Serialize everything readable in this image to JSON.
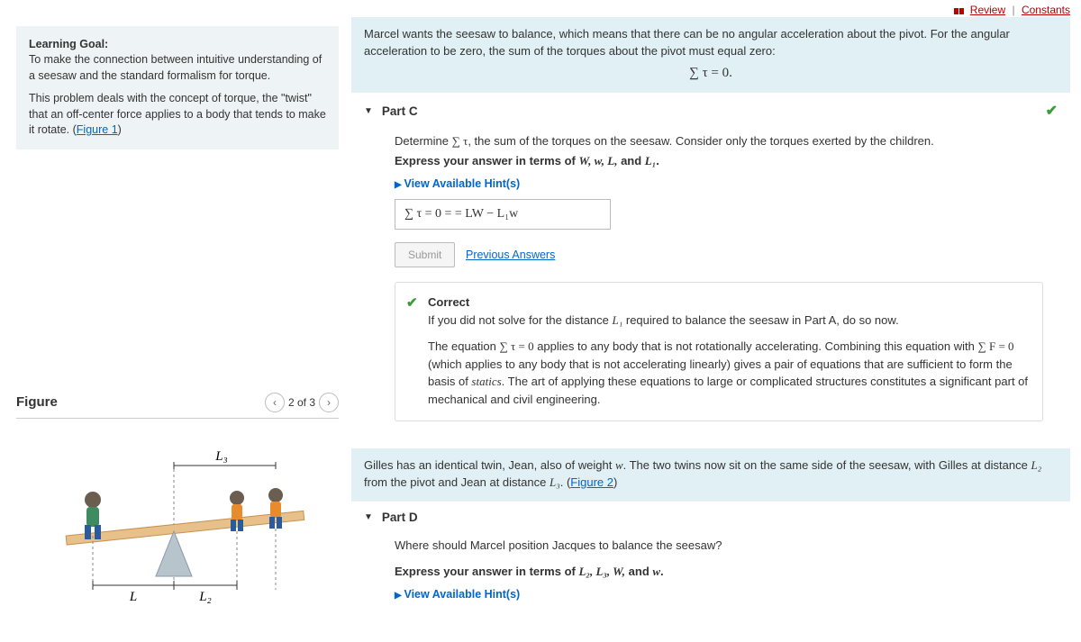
{
  "top": {
    "review": "Review",
    "constants": "Constants"
  },
  "goal": {
    "heading": "Learning Goal:",
    "text1": "To make the connection between intuitive understanding of a seesaw and the standard formalism for torque.",
    "text2a": "This problem deals with the concept of torque, the \"twist\" that an off-center force applies to a body that tends to make it rotate. (",
    "fig_link": "Figure 1",
    "text2b": ")"
  },
  "figure": {
    "title": "Figure",
    "pager": "2 of 3",
    "L3": "L₃",
    "L": "L",
    "L2": "L₂"
  },
  "intro": {
    "text": "Marcel wants the seesaw to balance, which means that there can be no angular acceleration about the pivot. For the angular acceleration to be zero, the sum of the torques about the pivot must equal zero:",
    "eqn": "∑ τ = 0."
  },
  "partC": {
    "title": "Part C",
    "q1a": "Determine ",
    "q1sum": "∑ τ",
    "q1b": ", the sum of the torques on the seesaw. Consider only the torques exerted by the children.",
    "instr_a": "Express your answer in terms of ",
    "instr_vars": "W, w, L,",
    "instr_b": " and ",
    "instr_L1": "L₁",
    "instr_c": ".",
    "hints": "View Available Hint(s)",
    "answer": "∑ τ = 0 = =  LW − L₁w",
    "submit": "Submit",
    "prev": "Previous Answers",
    "fb_title": "Correct",
    "fb_p1a": "If you did not solve for the distance ",
    "fb_L1": "L₁",
    "fb_p1b": " required to balance the seesaw in Part A, do so now.",
    "fb_p2a": "The equation ",
    "fb_eq1": "∑ τ = 0",
    "fb_p2b": " applies to any body that is not rotationally accelerating. Combining this equation with ",
    "fb_eq2": "∑ F = 0",
    "fb_p2c": " (which applies to any body that is not accelerating linearly) gives a pair of equations that are sufficient to form the basis of ",
    "fb_statics": "statics",
    "fb_p2d": ". The art of applying these equations to large or complicated structures constitutes a significant part of mechanical and civil engineering."
  },
  "mid": {
    "text_a": "Gilles has an identical twin, Jean, also of weight ",
    "w": "w",
    "text_b": ". The two twins now sit on the same side of the seesaw, with Gilles at distance ",
    "L2": "L₂",
    "text_c": " from the pivot and Jean at distance ",
    "L3": "L₃",
    "text_d": ". (",
    "fig_link": "Figure 2",
    "text_e": ")"
  },
  "partD": {
    "title": "Part D",
    "q": "Where should Marcel position Jacques to balance the seesaw?",
    "instr_a": "Express your answer in terms of ",
    "instr_vars": "L₂, L₃, W,",
    "instr_b": " and ",
    "instr_w": "w",
    "instr_c": ".",
    "hints": "View Available Hint(s)"
  }
}
